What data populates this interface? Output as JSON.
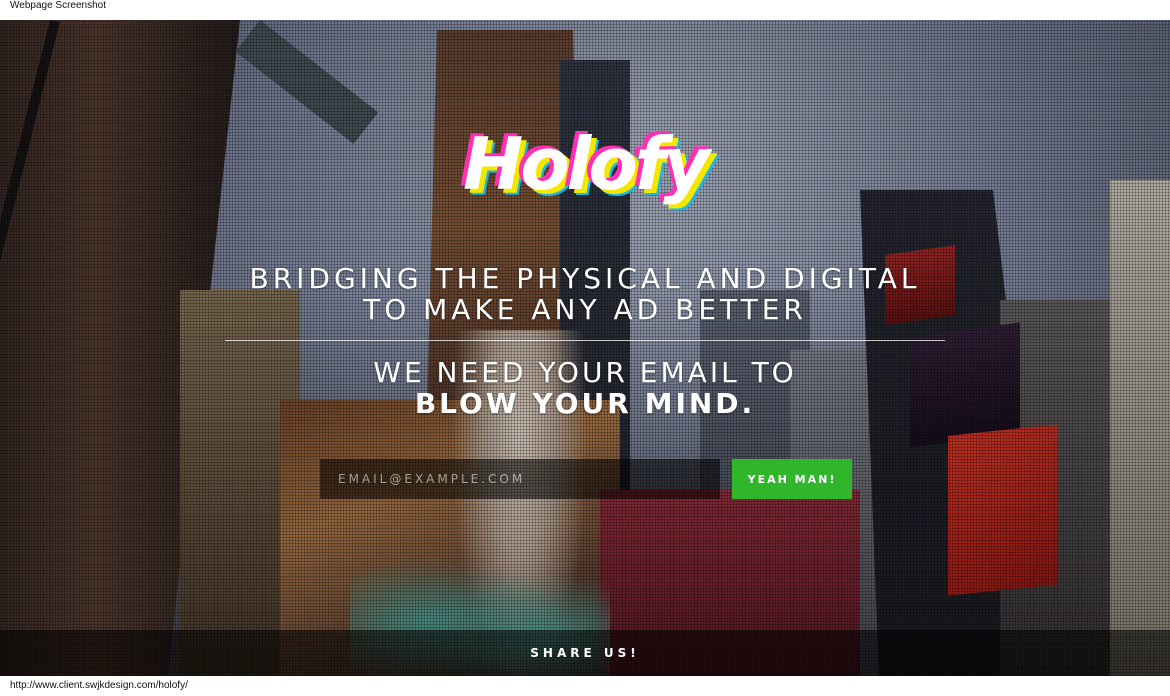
{
  "window": {
    "title": "Webpage Screenshot",
    "url": "http://www.client.swjkdesign.com/holofy/"
  },
  "hero": {
    "logo_text": "Holofy",
    "headline_line1": "BRIDGING THE PHYSICAL AND DIGITAL",
    "headline_line2": "TO MAKE ANY AD BETTER",
    "subhead_line1": "WE NEED YOUR EMAIL TO",
    "subhead_line2": "BLOW YOUR MIND."
  },
  "signup": {
    "email_placeholder": "EMAIL@EXAMPLE.COM",
    "email_value": "",
    "submit_label": "YEAH MAN!"
  },
  "footer_bar": {
    "share_label": "SHARE US!"
  },
  "colors": {
    "submit_button": "#2fb62a",
    "logo_shadow_magenta": "#ff2fb4",
    "logo_shadow_yellow": "#f5e600",
    "logo_shadow_cyan": "#18b7ee"
  }
}
